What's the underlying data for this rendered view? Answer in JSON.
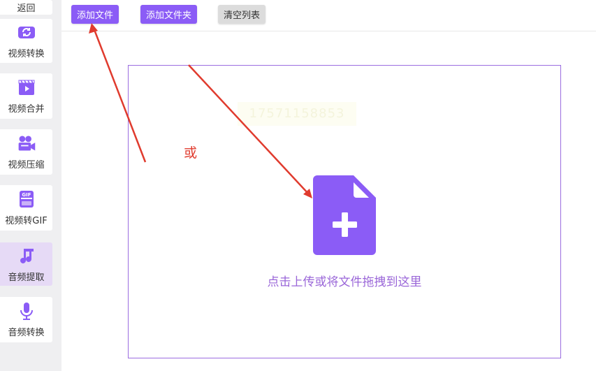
{
  "sidebar": {
    "back_label": "返回",
    "items": [
      {
        "label": "视频转换",
        "icon": "video-convert-icon"
      },
      {
        "label": "视频合并",
        "icon": "video-merge-icon"
      },
      {
        "label": "视频压缩",
        "icon": "video-compress-icon"
      },
      {
        "label": "视频转GIF",
        "icon": "gif-icon"
      },
      {
        "label": "音频提取",
        "icon": "music-note-icon",
        "active": true
      },
      {
        "label": "音频转换",
        "icon": "microphone-icon"
      }
    ]
  },
  "toolbar": {
    "add_file_label": "添加文件",
    "add_folder_label": "添加文件夹",
    "clear_list_label": "清空列表"
  },
  "drop_zone": {
    "hint": "点击上传或将文件拖拽到这里",
    "icon": "file-add-icon"
  },
  "annotation": {
    "or_label": "或",
    "watermark": "17571158853"
  },
  "colors": {
    "accent": "#8b5cf6",
    "active_bg": "#e6daf6",
    "drop_text": "#9a66d8",
    "annotation_red": "#e03b2e",
    "sidebar_bg": "#efeff1"
  }
}
